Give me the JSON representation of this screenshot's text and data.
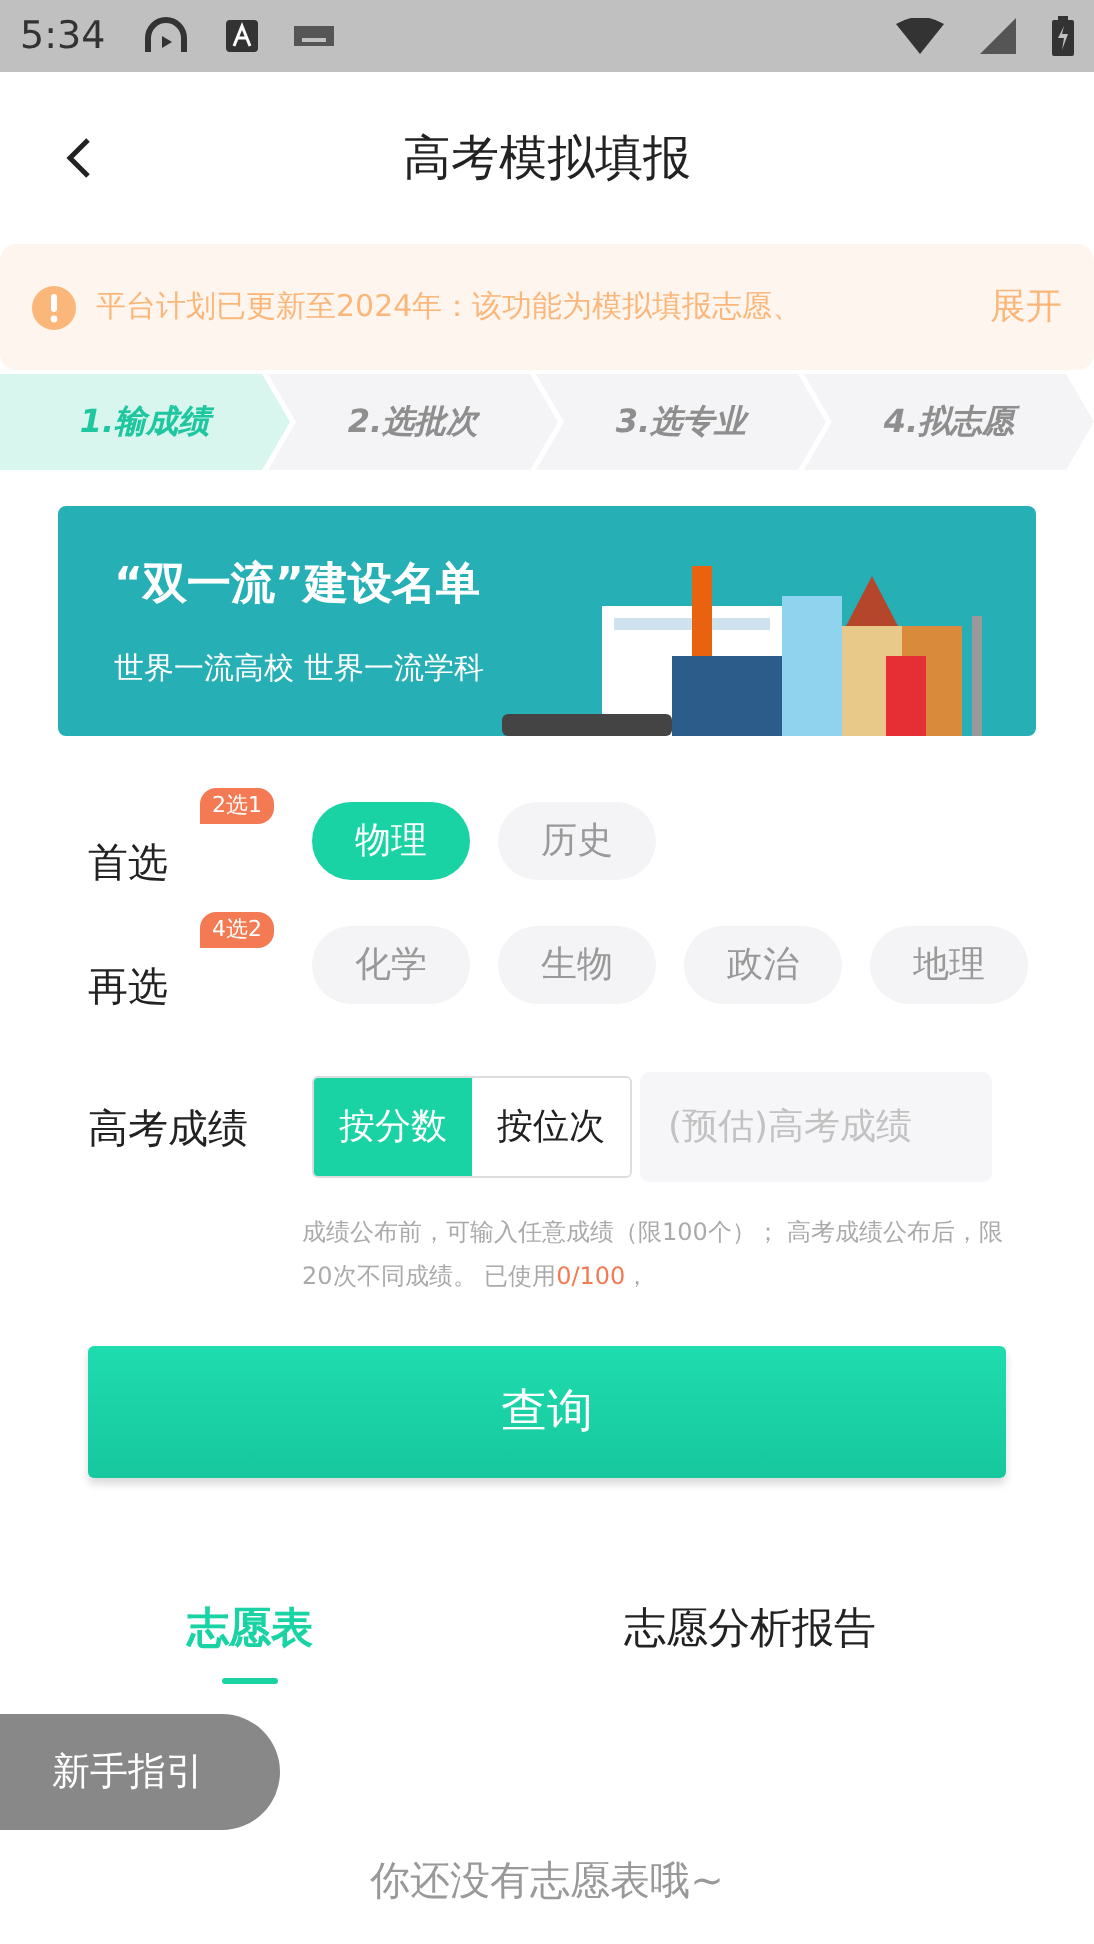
{
  "status_bar": {
    "time": "5:34"
  },
  "header": {
    "title": "高考模拟填报"
  },
  "notice": {
    "text": "平台计划已更新至2024年：该功能为模拟填报志愿、",
    "action": "展开"
  },
  "steps": [
    {
      "label": "1.输成绩",
      "selected": true
    },
    {
      "label": "2.选批次",
      "selected": false
    },
    {
      "label": "3.选专业",
      "selected": false
    },
    {
      "label": "4.拟志愿",
      "selected": false
    }
  ],
  "banner": {
    "title": "“双一流”建设名单",
    "subtitle": "世界一流高校 世界一流学科"
  },
  "subject_groups": [
    {
      "label": "首选",
      "badge": "2选1",
      "options": [
        {
          "label": "物理",
          "selected": true
        },
        {
          "label": "历史",
          "selected": false
        }
      ]
    },
    {
      "label": "再选",
      "badge": "4选2",
      "options": [
        {
          "label": "化学",
          "selected": false
        },
        {
          "label": "生物",
          "selected": false
        },
        {
          "label": "政治",
          "selected": false
        },
        {
          "label": "地理",
          "selected": false
        }
      ]
    }
  ],
  "score": {
    "label": "高考成绩",
    "modes": [
      {
        "label": "按分数",
        "selected": true
      },
      {
        "label": "按位次",
        "selected": false
      }
    ],
    "input": {
      "placeholder": "(预估)高考成绩"
    },
    "hint_before": "成绩公布前，可输入任意成绩（限100个）； 高考成绩公布后，限20次不同成绩。 已使用",
    "usage": "0/100",
    "hint_after": "，"
  },
  "query_button": "查询",
  "result_tabs": [
    {
      "label": "志愿表",
      "selected": true
    },
    {
      "label": "志愿分析报告",
      "selected": false
    }
  ],
  "guide_button": "新手指引",
  "empty_message": "你还没有志愿表哦~"
}
